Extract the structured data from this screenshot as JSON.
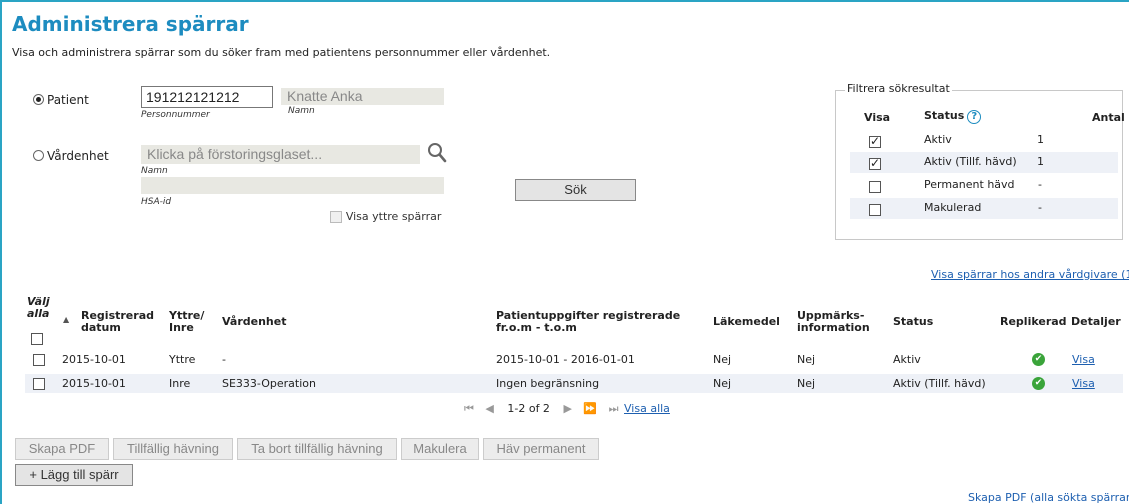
{
  "header": {
    "title": "Administrera spärrar",
    "subtitle": "Visa och administrera spärrar som du söker fram med patientens personnummer eller vårdenhet."
  },
  "search": {
    "patient_label": "Patient",
    "personnummer_value": "191212121212",
    "personnummer_caption": "Personnummer",
    "name_value": "Knatte Anka",
    "name_caption": "Namn",
    "vardenhet_label": "Vårdenhet",
    "vardenhet_placeholder": "Klicka på förstoringsglaset...",
    "vardenhet_name_caption": "Namn",
    "hsa_value": "",
    "hsa_caption": "HSA-id",
    "show_external_label": "Visa yttre spärrar",
    "search_button": "Sök"
  },
  "filter": {
    "legend": "Filtrera sökresultat",
    "headers": {
      "visa": "Visa",
      "status": "Status",
      "antal": "Antal"
    },
    "rows": [
      {
        "checked": true,
        "status": "Aktiv",
        "count": "1"
      },
      {
        "checked": true,
        "status": "Aktiv (Tillf. hävd)",
        "count": "1"
      },
      {
        "checked": false,
        "status": "Permanent hävd",
        "count": "-"
      },
      {
        "checked": false,
        "status": "Makulerad",
        "count": "-"
      }
    ]
  },
  "other_caregivers_link": "Visa spärrar hos andra vårdgivare (1",
  "table": {
    "headers": {
      "select_all": "Välj alla",
      "registered": "Registrerad datum",
      "type": "Yttre/ Inre",
      "unit": "Vårdenhet",
      "patient_data": "Patientuppgifter registrerade fr.o.m - t.o.m",
      "medicine": "Läkemedel",
      "notice": "Uppmärks-information",
      "status": "Status",
      "replicated": "Replikerad",
      "details": "Detaljer"
    },
    "rows": [
      {
        "date": "2015-10-01",
        "type": "Yttre",
        "unit": "-",
        "period": "2015-10-01 - 2016-01-01",
        "medicine": "Nej",
        "notice": "Nej",
        "status": "Aktiv",
        "details": "Visa"
      },
      {
        "date": "2015-10-01",
        "type": "Inre",
        "unit": "SE333-Operation",
        "period": "Ingen begränsning",
        "medicine": "Nej",
        "notice": "Nej",
        "status": "Aktiv (Tillf. hävd)",
        "details": "Visa"
      }
    ]
  },
  "pagination": {
    "range": "1-2 of 2",
    "show_all": "Visa alla"
  },
  "actions": {
    "create_pdf": "Skapa PDF",
    "temp_revoke": "Tillfällig hävning",
    "remove_temp_revoke": "Ta bort tillfällig hävning",
    "cancel": "Makulera",
    "revoke_permanent": "Häv permanent",
    "add_block": "+ Lägg till spärr",
    "create_pdf_all": "Skapa PDF (alla sökta spärrar"
  },
  "colors": {
    "accent": "#1d8cc0",
    "frame": "#2aa4c4",
    "link": "#1d5fb0",
    "ok_green": "#3aa43a",
    "row_alt": "#eef1f7"
  },
  "icons": {
    "search": "magnifier-icon",
    "replicated": "check-circle-icon",
    "help": "question-icon"
  }
}
